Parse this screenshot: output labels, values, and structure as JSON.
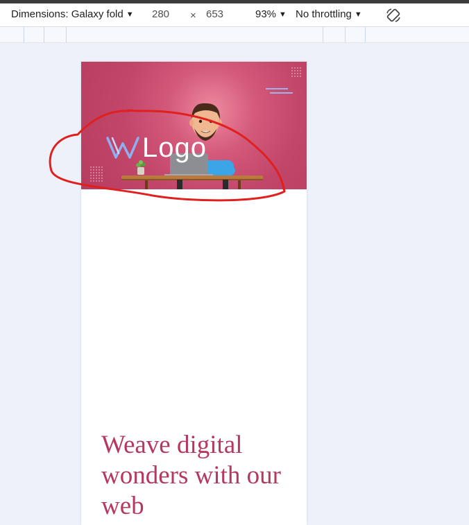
{
  "devtools": {
    "device_label": "Dimensions: Galaxy fold",
    "width": "280",
    "times": "×",
    "height": "653",
    "zoom": "93%",
    "throttling": "No throttling",
    "rotate_icon": "rotate-device-icon"
  },
  "site": {
    "logo_text": "Logo",
    "headline": "Weave digital wonders with our web"
  },
  "colors": {
    "hero": "#c1466a",
    "headline": "#b5385f",
    "annotation": "#e0201e"
  }
}
